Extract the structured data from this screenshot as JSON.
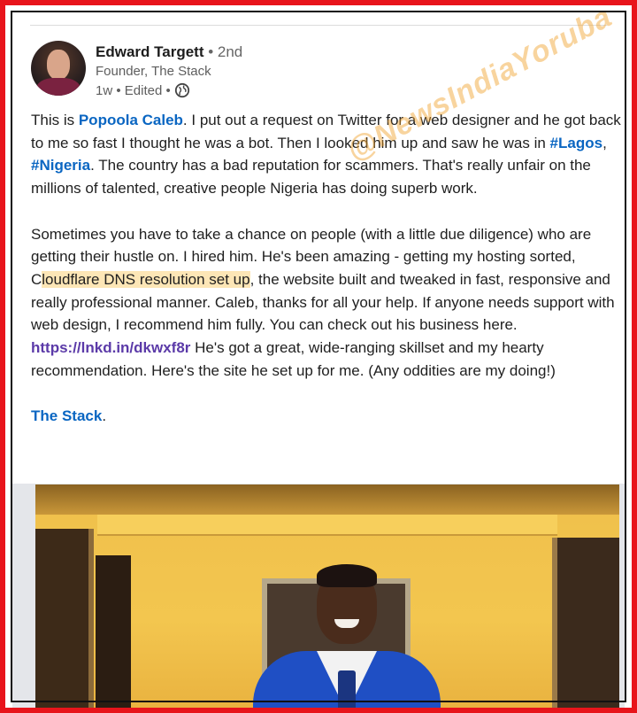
{
  "author": {
    "name": "Edward Targett",
    "degree": "• 2nd",
    "title": "Founder, The Stack",
    "meta": "1w • Edited •"
  },
  "post": {
    "p1_a": "This is ",
    "p1_link_name": "Popoola Caleb",
    "p1_b": ". I put out a request on Twitter for a web designer and he got back to me so fast I thought he was a bot. Then I looked him up and saw he was in ",
    "p1_tag1": "#Lagos",
    "p1_sep": ", ",
    "p1_tag2": "#Nigeria",
    "p1_c": ". The country has a bad reputation for scammers. That's really unfair on the millions of talented, creative people Nigeria has doing superb work.",
    "p2_a": "Sometimes you have to take a chance on people (with a little due diligence) who are getting their hustle on. I hired him. He's been amazing - getting my hosting sorted, C",
    "p2_hl": "loudflare DNS resolution set up",
    "p2_b": ", the website built and tweaked in fast, responsive and really professional manner. Caleb, thanks for all your help. If anyone needs support with web design, I recommend him fully. You can check out his business here. ",
    "p2_url": "https://lnkd.in/dkwxf8r",
    "p2_c": " He's got a great, wide-ranging skillset and my hearty recommendation. Here's the site he set up for me. (Any oddities are my doing!)",
    "p3_link": "The Stack",
    "p3_end": "."
  },
  "watermark": "@NewsIndiaYoruba",
  "colors": {
    "frame": "#e8141b",
    "link": "#0a66c2",
    "url": "#5b3aa8",
    "highlight": "#fde6b6"
  }
}
